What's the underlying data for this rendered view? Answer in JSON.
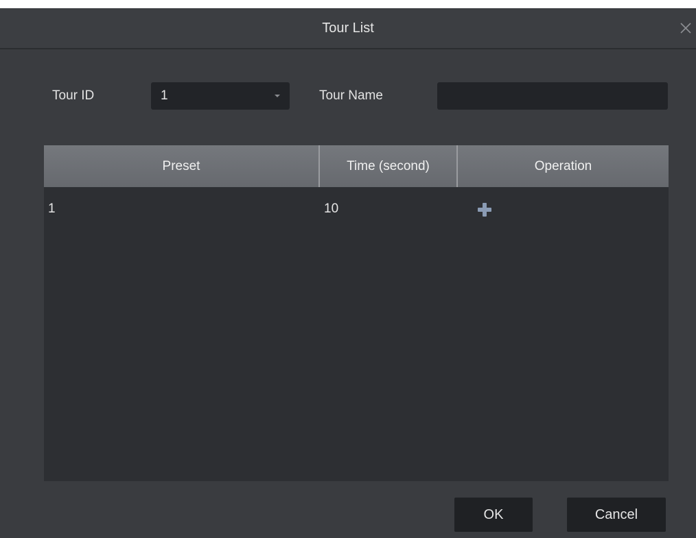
{
  "dialog": {
    "title": "Tour List",
    "close_icon": "close-icon"
  },
  "form": {
    "tour_id_label": "Tour ID",
    "tour_id_value": "1",
    "tour_name_label": "Tour Name",
    "tour_name_value": ""
  },
  "table": {
    "columns": [
      "Preset",
      "Time (second)",
      "Operation"
    ],
    "rows": [
      {
        "preset": "1",
        "time": "10",
        "operation_icon": "add-icon"
      }
    ]
  },
  "buttons": {
    "ok": "OK",
    "cancel": "Cancel"
  },
  "colors": {
    "background": "#3a3c40",
    "header": "#6e7176",
    "add_icon": "#8a9bb4"
  }
}
